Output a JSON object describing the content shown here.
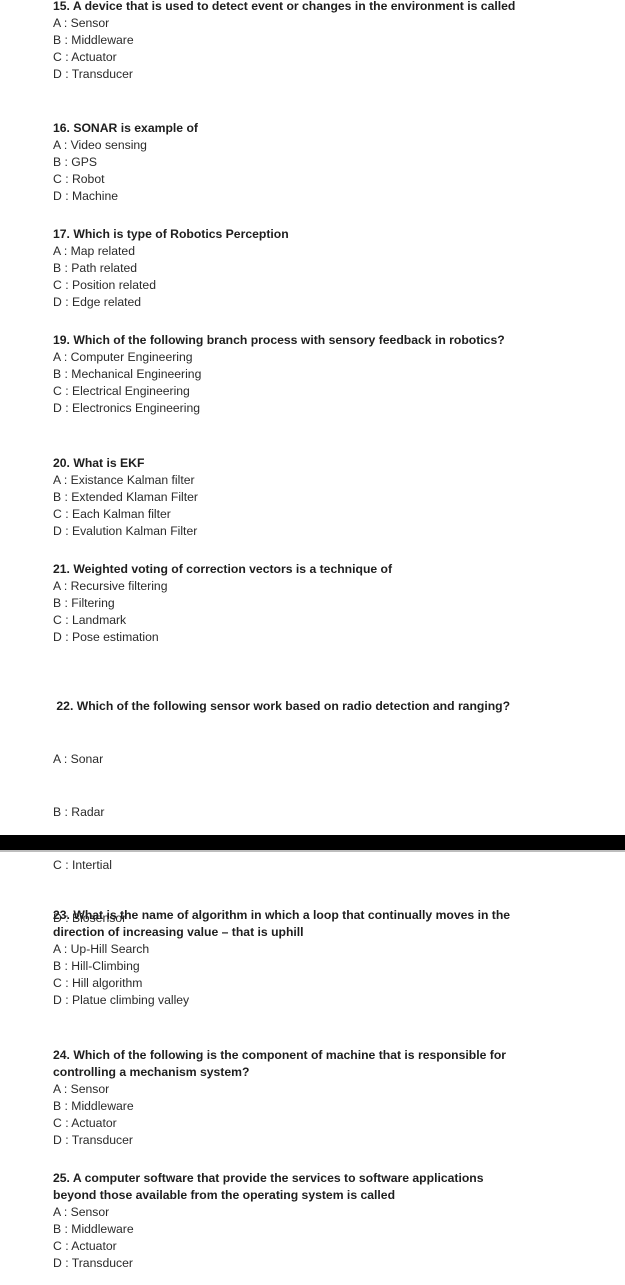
{
  "questions": [
    {
      "number": "15.",
      "title": "15. A device that is used to detect event or changes in the environment is called",
      "options": [
        "A : Sensor",
        "B : Middleware",
        "C : Actuator",
        "D : Transducer"
      ]
    },
    {
      "number": "16.",
      "title": "16. SONAR is example of",
      "options": [
        "A : Video sensing",
        "B : GPS",
        "C : Robot",
        "D : Machine"
      ]
    },
    {
      "number": "17.",
      "title": "17. Which is type of Robotics Perception",
      "options": [
        "A : Map related",
        "B : Path related",
        "C : Position related",
        "D : Edge related"
      ]
    },
    {
      "number": "19.",
      "title": "19. Which of the following branch process with sensory feedback in robotics?",
      "options": [
        "A : Computer Engineering",
        "B : Mechanical Engineering",
        "C : Electrical Engineering",
        "D : Electronics Engineering"
      ]
    },
    {
      "number": "20.",
      "title": "20. What is EKF",
      "options": [
        "A : Existance Kalman filter",
        "B : Extended Klaman Filter",
        "C : Each Kalman filter",
        "D : Evalution Kalman Filter"
      ]
    },
    {
      "number": "21.",
      "title": "21. Weighted voting of correction vectors is a technique of",
      "options": [
        "A : Recursive filtering",
        "B : Filtering",
        "C : Landmark",
        "D : Pose estimation"
      ]
    },
    {
      "number": "22.",
      "title": " 22. Which of the following sensor work based on radio detection and ranging?",
      "options": [
        "A : Sonar",
        "B : Radar",
        "C : Intertial",
        "D : Biosensor"
      ]
    },
    {
      "number": "23.",
      "title": "23. What is the name of algorithm in which a loop that continually moves in the direction of increasing value – that is uphill",
      "options": [
        "A : Up-Hill Search",
        "B : Hill-Climbing",
        "C : Hill algorithm",
        "D : Platue climbing valley"
      ]
    },
    {
      "number": "24.",
      "title": "24. Which of the following is the component of machine that is responsible for controlling a mechanism system?",
      "options": [
        "A : Sensor",
        "B : Middleware",
        "C : Actuator",
        "D : Transducer"
      ]
    },
    {
      "number": "25.",
      "title": "25. A computer software that provide the services to software applications beyond those available from the operating system is called",
      "options": [
        "A : Sensor",
        "B : Middleware",
        "C : Actuator",
        "D : Transducer"
      ]
    }
  ]
}
